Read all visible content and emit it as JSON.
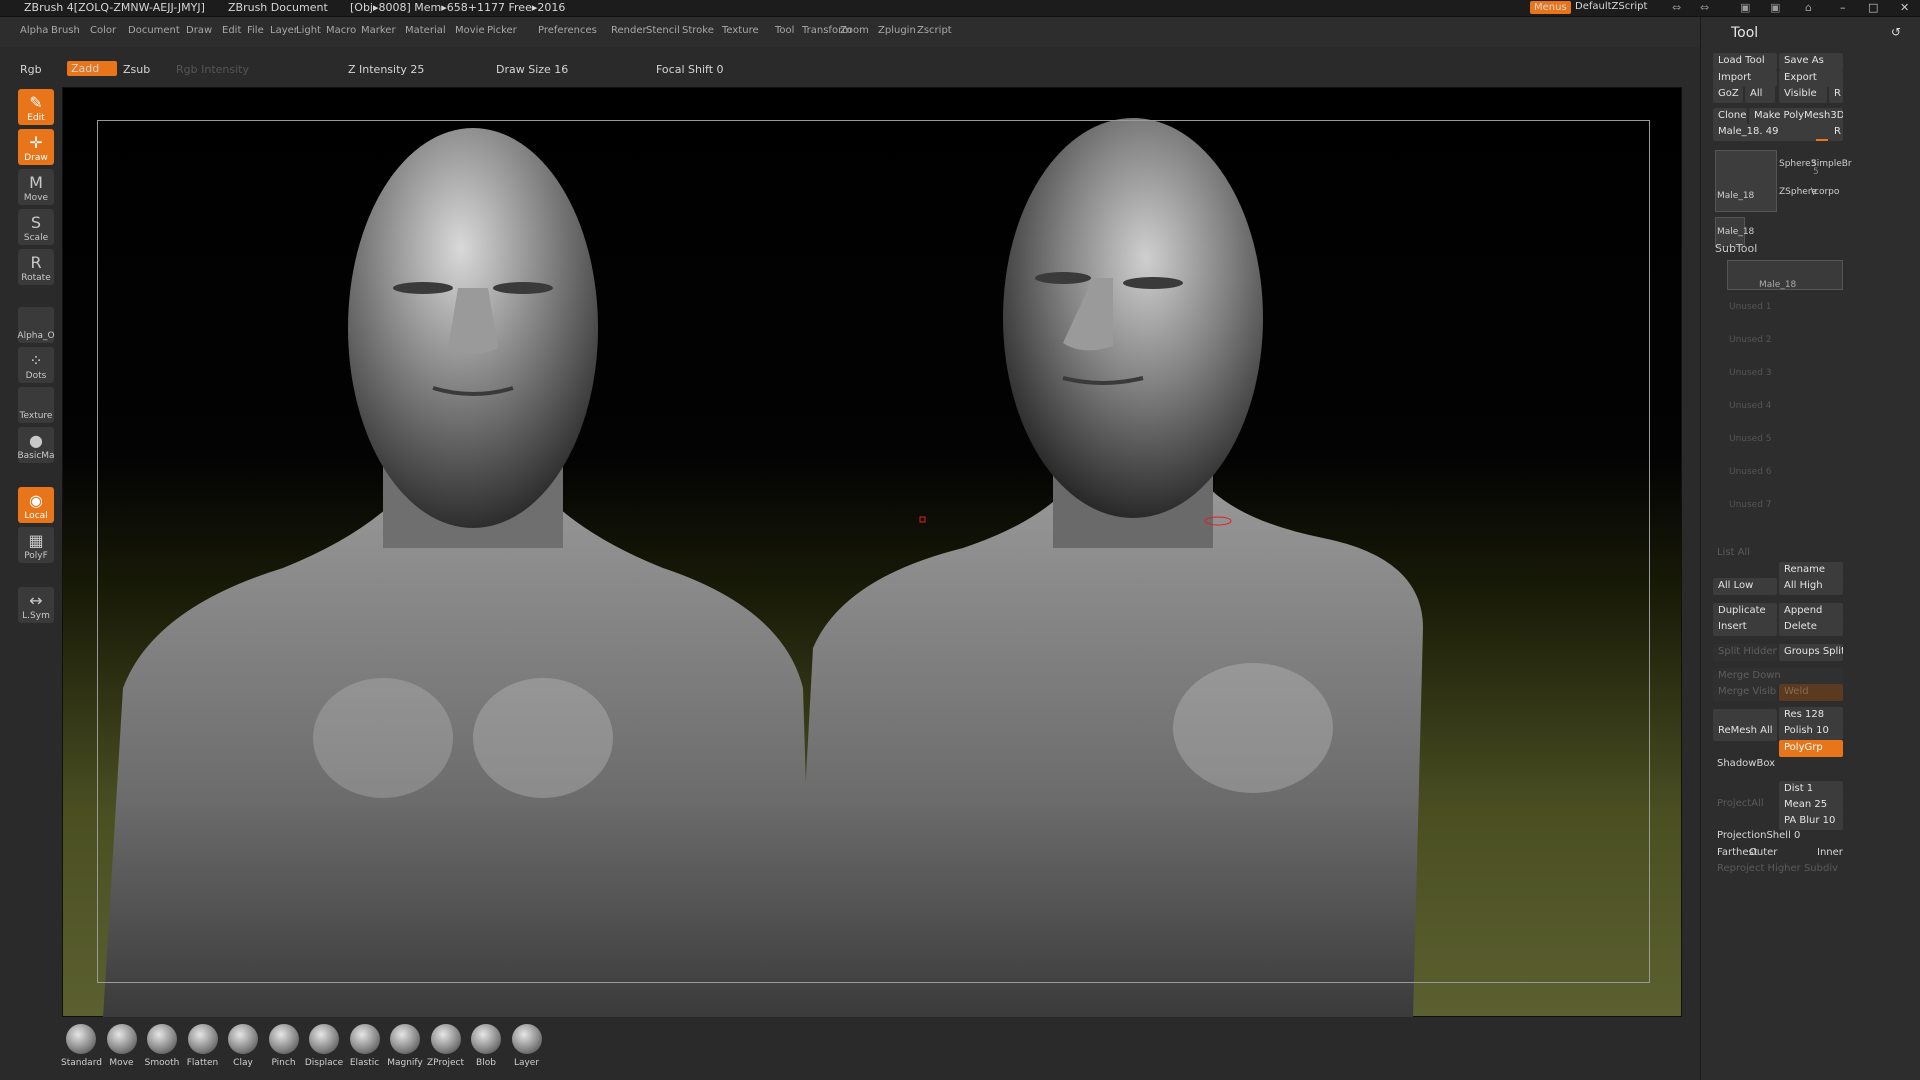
{
  "titlebar": {
    "app": "ZBrush 4[ZOLQ-ZMNW-AEJJ-JMYJ]",
    "doc": "ZBrush Document",
    "stats": "[Obj▸8008] Mem▸658+1177 Free▸2016",
    "menus_btn": "Menus",
    "script": "DefaultZScript"
  },
  "menubar": [
    "Alpha",
    "Brush",
    "Color",
    "Document",
    "Draw",
    "Edit",
    "File",
    "Layer",
    "Light",
    "Macro",
    "Marker",
    "Material",
    "Movie",
    "Picker",
    "Preferences",
    "Render",
    "Stencil",
    "Stroke",
    "Texture",
    "Tool",
    "Transform",
    "Zoom",
    "Zplugin",
    "Zscript"
  ],
  "topctl": {
    "rgb": "Rgb",
    "zadd": "Zadd",
    "zsub": "Zsub",
    "rgb_intensity": "Rgb Intensity",
    "z_intensity": "Z Intensity 25",
    "draw_size": "Draw Size 16",
    "focal_shift": "Focal Shift 0"
  },
  "lefttools": [
    {
      "label": "Edit",
      "icon": "✎",
      "on": true
    },
    {
      "label": "Draw",
      "icon": "✛",
      "on": true
    },
    {
      "label": "Move",
      "icon": "M",
      "on": false
    },
    {
      "label": "Scale",
      "icon": "S",
      "on": false
    },
    {
      "label": "Rotate",
      "icon": "R",
      "on": false
    },
    {
      "label": "Alpha_O",
      "icon": "",
      "on": false
    },
    {
      "label": "Dots",
      "icon": "⁘",
      "on": false
    },
    {
      "label": "Texture",
      "icon": "",
      "on": false
    },
    {
      "label": "BasicMa",
      "icon": "●",
      "on": false
    },
    {
      "label": "Local",
      "icon": "◉",
      "on": true
    },
    {
      "label": "PolyF",
      "icon": "▦",
      "on": false
    },
    {
      "label": "L.Sym",
      "icon": "↔",
      "on": false
    }
  ],
  "brushes": [
    "Standard",
    "Move",
    "Smooth",
    "Flatten",
    "Clay",
    "Pinch",
    "Displace",
    "Elastic",
    "Magnify",
    "ZProject",
    "Blob",
    "Layer"
  ],
  "tool": {
    "title": "Tool",
    "load_tool": "Load Tool",
    "save_as": "Save As",
    "import": "Import",
    "export": "Export",
    "goz": "GoZ",
    "all": "All",
    "visible": "Visible",
    "r": "R",
    "clone": "Clone",
    "make_polymesh": "Make PolyMesh3D",
    "current": "Male_18. 49",
    "thumbs": [
      "Male_18",
      "Sphere3",
      "SimpleBr",
      "ZSphere",
      "\\corpo",
      "Male_18"
    ],
    "thumb_count": "5"
  },
  "subtool": {
    "title": "SubTool",
    "active": "Male_18",
    "unused": [
      "Unused 1",
      "Unused 2",
      "Unused 3",
      "Unused 4",
      "Unused 5",
      "Unused 6",
      "Unused 7"
    ],
    "list_all": "List All",
    "rename": "Rename",
    "all_low": "All Low",
    "all_high": "All High",
    "duplicate": "Duplicate",
    "append": "Append",
    "insert": "Insert",
    "delete": "Delete",
    "split_hidden": "Split Hidden",
    "groups_split": "Groups Split",
    "merge_down": "Merge Down",
    "merge_visible": "Merge Visible",
    "weld": "Weld",
    "remesh_all": "ReMesh All",
    "res": "Res 128",
    "polish": "Polish 10",
    "polygrp": "PolyGrp",
    "shadowbox": "ShadowBox",
    "project_all": "ProjectAll",
    "dist": "Dist 1",
    "mean": "Mean 25",
    "pa_blur": "PA Blur 10",
    "projection_shell": "ProjectionShell 0",
    "farthest": "Farthest",
    "outer": "Outer",
    "inner": "Inner",
    "reproject": "Reproject Higher Subdiv"
  }
}
